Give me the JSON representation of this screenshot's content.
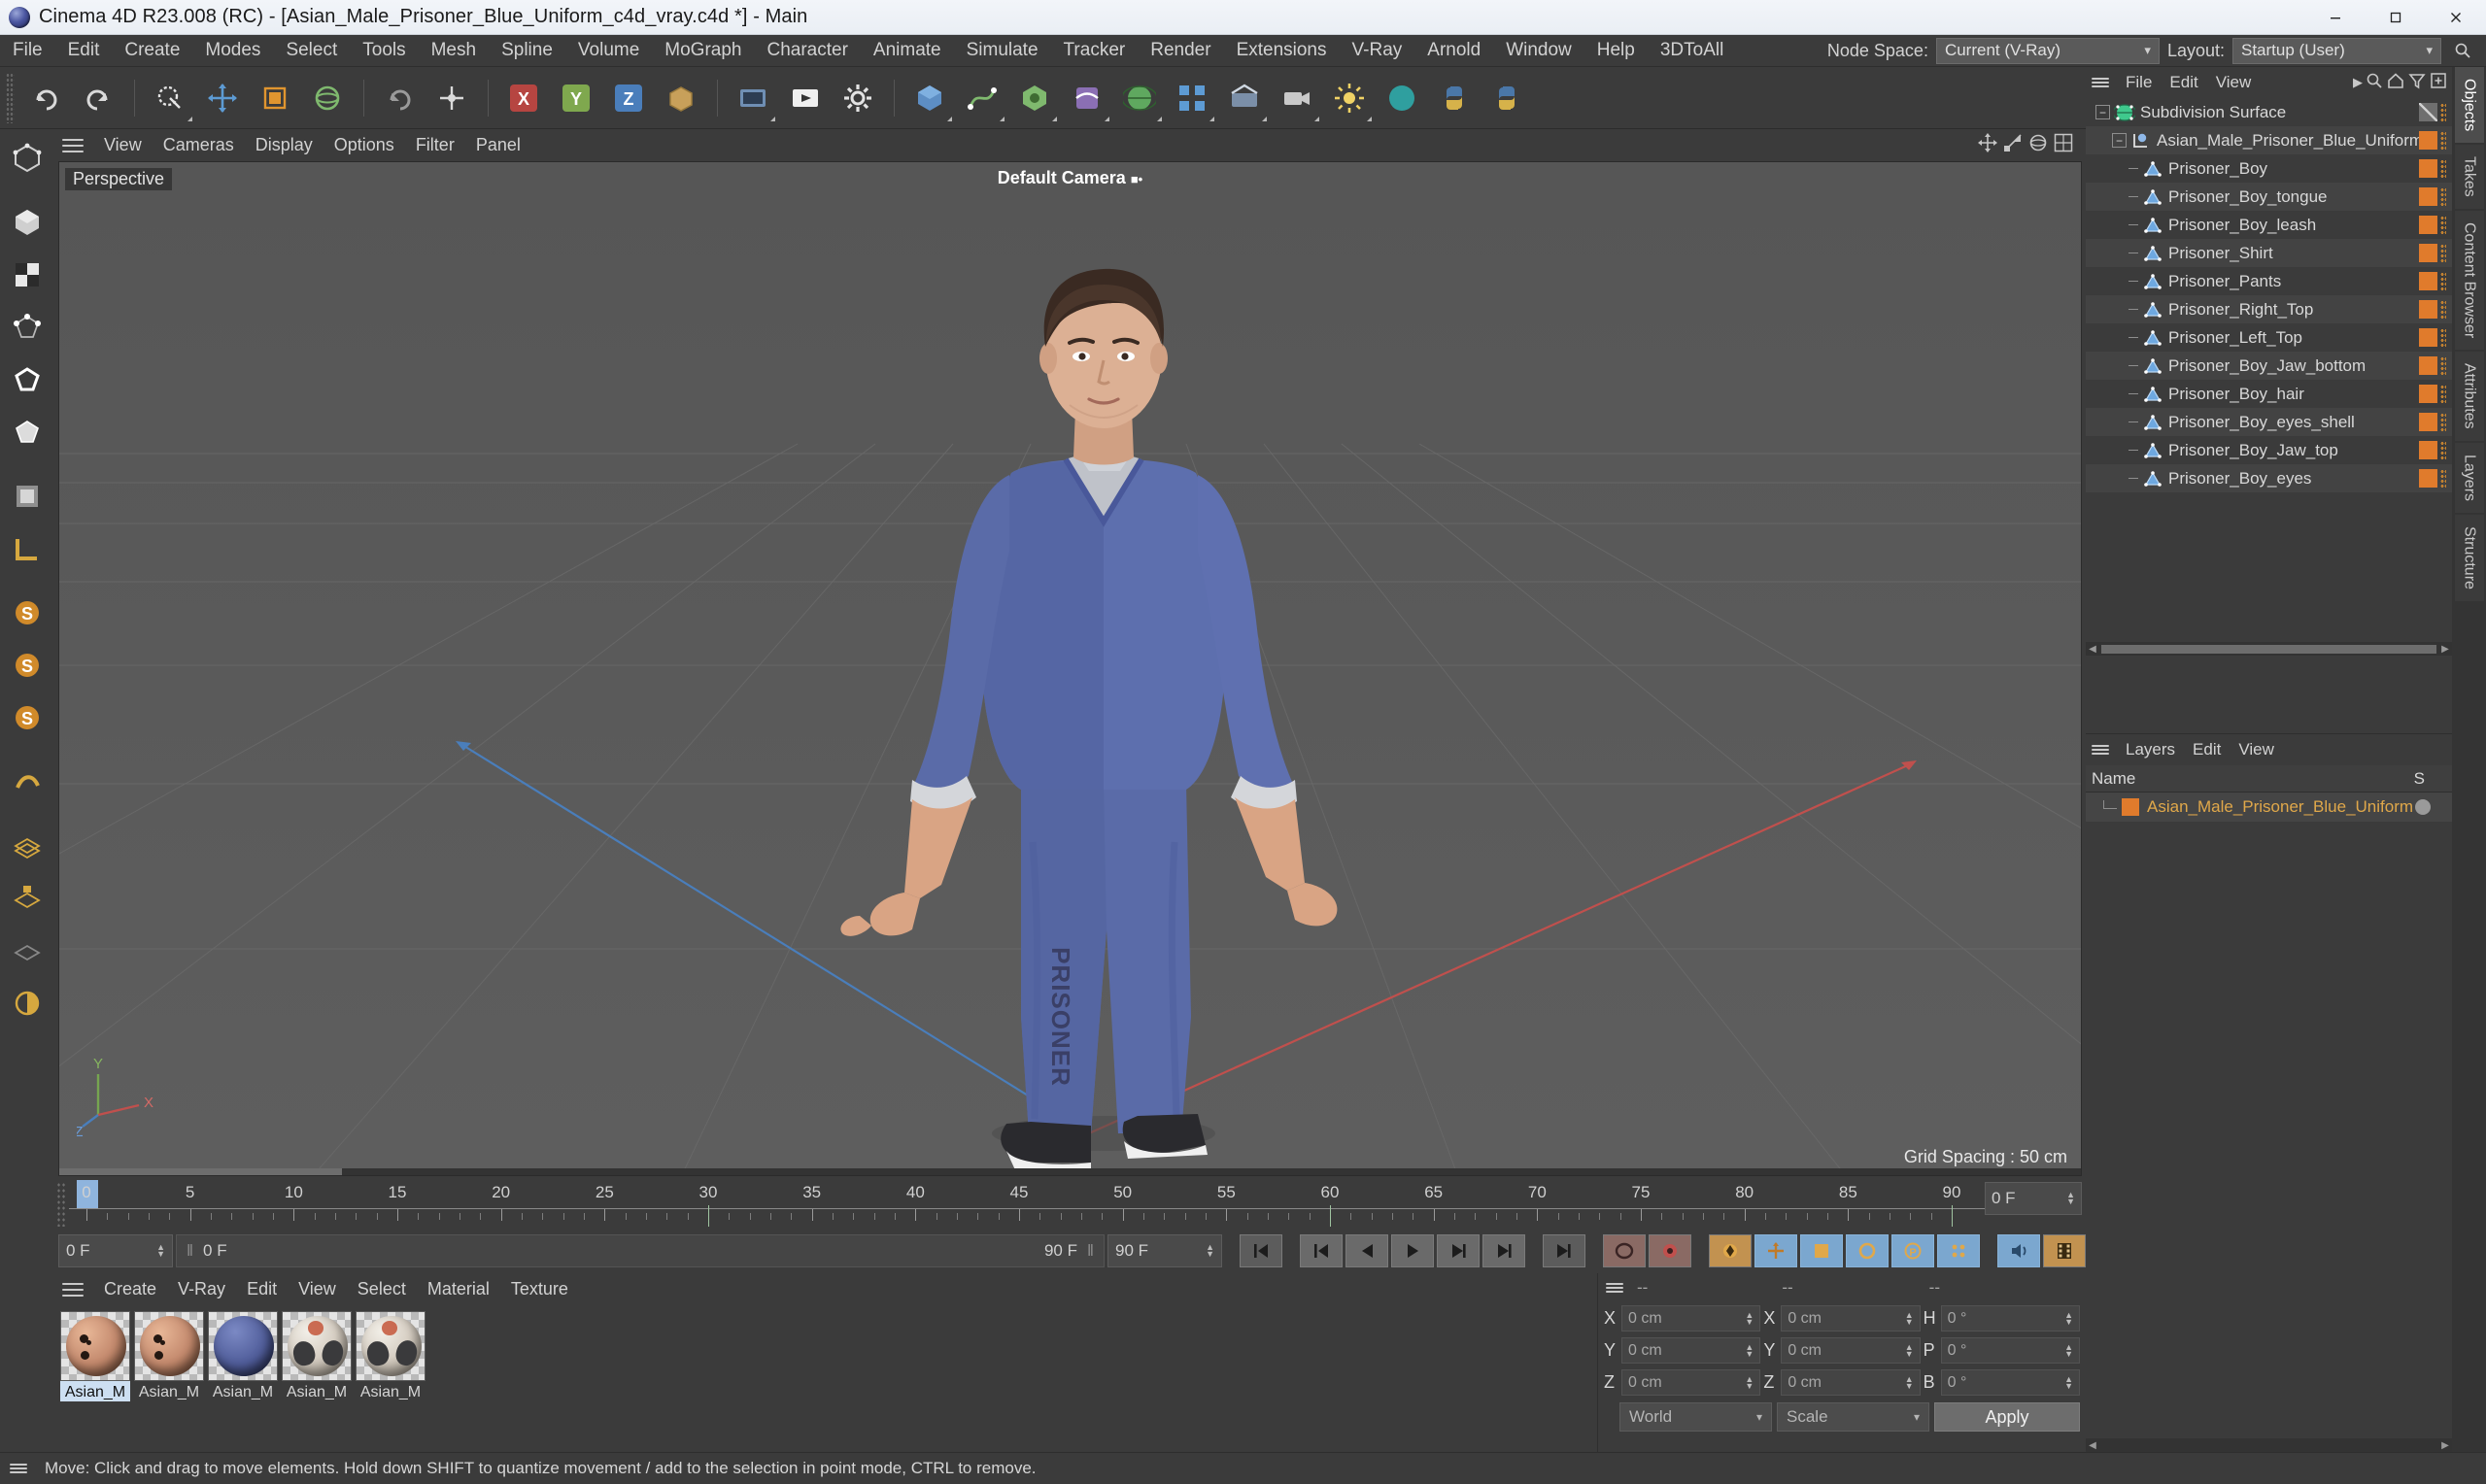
{
  "window": {
    "title": "Cinema 4D R23.008 (RC) - [Asian_Male_Prisoner_Blue_Uniform_c4d_vray.c4d *] - Main",
    "minimize_label": "Minimize",
    "maximize_label": "Maximize",
    "close_label": "Close"
  },
  "menubar": {
    "items": [
      "File",
      "Edit",
      "Create",
      "Modes",
      "Select",
      "Tools",
      "Mesh",
      "Spline",
      "Volume",
      "MoGraph",
      "Character",
      "Animate",
      "Simulate",
      "Tracker",
      "Render",
      "Extensions",
      "V-Ray",
      "Arnold",
      "Window",
      "Help",
      "3DToAll"
    ],
    "node_space_label": "Node Space:",
    "node_space_value": "Current (V-Ray)",
    "layout_label": "Layout:",
    "layout_value": "Startup (User)"
  },
  "viewport": {
    "menu": [
      "View",
      "Cameras",
      "Display",
      "Options",
      "Filter",
      "Panel"
    ],
    "perspective_label": "Perspective",
    "camera_label": "Default Camera",
    "grid_spacing": "Grid Spacing : 50 cm",
    "axis_x": "X",
    "axis_y": "Y",
    "axis_z": "Z"
  },
  "object_manager": {
    "menu": [
      "File",
      "Edit",
      "View"
    ],
    "tree": [
      {
        "name": "Subdivision Surface",
        "depth": 0,
        "icon": "subdivision-surface-icon",
        "tag": "grey"
      },
      {
        "name": "Asian_Male_Prisoner_Blue_Uniform",
        "depth": 1,
        "icon": "null-object-icon",
        "tag": "orange"
      },
      {
        "name": "Prisoner_Boy",
        "depth": 2,
        "icon": "polygon-object-icon",
        "tag": "orange"
      },
      {
        "name": "Prisoner_Boy_tongue",
        "depth": 2,
        "icon": "polygon-object-icon",
        "tag": "orange"
      },
      {
        "name": "Prisoner_Boy_leash",
        "depth": 2,
        "icon": "polygon-object-icon",
        "tag": "orange"
      },
      {
        "name": "Prisoner_Shirt",
        "depth": 2,
        "icon": "polygon-object-icon",
        "tag": "orange"
      },
      {
        "name": "Prisoner_Pants",
        "depth": 2,
        "icon": "polygon-object-icon",
        "tag": "orange"
      },
      {
        "name": "Prisoner_Right_Top",
        "depth": 2,
        "icon": "polygon-object-icon",
        "tag": "orange"
      },
      {
        "name": "Prisoner_Left_Top",
        "depth": 2,
        "icon": "polygon-object-icon",
        "tag": "orange"
      },
      {
        "name": "Prisoner_Boy_Jaw_bottom",
        "depth": 2,
        "icon": "polygon-object-icon",
        "tag": "orange"
      },
      {
        "name": "Prisoner_Boy_hair",
        "depth": 2,
        "icon": "polygon-object-icon",
        "tag": "orange"
      },
      {
        "name": "Prisoner_Boy_eyes_shell",
        "depth": 2,
        "icon": "polygon-object-icon",
        "tag": "orange"
      },
      {
        "name": "Prisoner_Boy_Jaw_top",
        "depth": 2,
        "icon": "polygon-object-icon",
        "tag": "orange"
      },
      {
        "name": "Prisoner_Boy_eyes",
        "depth": 2,
        "icon": "polygon-object-icon",
        "tag": "orange"
      }
    ]
  },
  "layers_panel": {
    "menu": [
      "Layers",
      "Edit",
      "View"
    ],
    "header_name": "Name",
    "header_s": "S",
    "rows": [
      {
        "name": "Asian_Male_Prisoner_Blue_Uniform",
        "color": "#e07b2c"
      }
    ]
  },
  "vertical_tabs": [
    "Objects",
    "Takes",
    "Content Browser",
    "Attributes",
    "Layers",
    "Structure"
  ],
  "timeline": {
    "ticks": [
      0,
      5,
      10,
      15,
      20,
      25,
      30,
      35,
      40,
      45,
      50,
      55,
      60,
      65,
      70,
      75,
      80,
      85,
      90
    ],
    "start": 0,
    "end": 90,
    "current_frame_label": "0 F",
    "end_frame_label": "90 F",
    "preview_end_label": "90 F",
    "right_frame_label": "0 F",
    "left_frame_label": "0 F",
    "second_frame_label": "0 F"
  },
  "material_manager": {
    "menu": [
      "Create",
      "V-Ray",
      "Edit",
      "View",
      "Select",
      "Material",
      "Texture"
    ],
    "materials": [
      {
        "label": "Asian_M",
        "color": "#c48a6e",
        "selected": true,
        "kind": "skin"
      },
      {
        "label": "Asian_M",
        "color": "#c48a6e",
        "selected": false,
        "kind": "skin"
      },
      {
        "label": "Asian_M",
        "color": "#505d9a",
        "selected": false,
        "kind": "cloth"
      },
      {
        "label": "Asian_M",
        "color": "#d7cfc4",
        "selected": false,
        "kind": "shoe"
      },
      {
        "label": "Asian_M",
        "color": "#d7cfc4",
        "selected": false,
        "kind": "shoe"
      }
    ]
  },
  "coordinates": {
    "title_dashes": [
      "--",
      "--",
      "--"
    ],
    "rows": [
      {
        "label1": "X",
        "value1": "0 cm",
        "label2": "X",
        "value2": "0 cm",
        "label3": "H",
        "value3": "0 °"
      },
      {
        "label1": "Y",
        "value1": "0 cm",
        "label2": "Y",
        "value2": "0 cm",
        "label3": "P",
        "value3": "0 °"
      },
      {
        "label1": "Z",
        "value1": "0 cm",
        "label2": "Z",
        "value2": "0 cm",
        "label3": "B",
        "value3": "0 °"
      }
    ],
    "world_value": "World",
    "scale_value": "Scale",
    "apply_label": "Apply"
  },
  "statusbar": {
    "message": "Move: Click and drag to move elements. Hold down SHIFT to quantize movement / add to the selection in point mode, CTRL to remove."
  },
  "colors": {
    "panel_bg": "#3b3b3b",
    "viewport_bg": "#5a5a5a",
    "accent_orange": "#e07b2c",
    "accent_blue": "#7ba7cf",
    "text": "#d2d2d2",
    "uniform_blue": "#5a6ba8",
    "axis_x_red": "#c0504d",
    "axis_z_blue": "#4a7ebb",
    "axis_y_green": "#76a550"
  }
}
